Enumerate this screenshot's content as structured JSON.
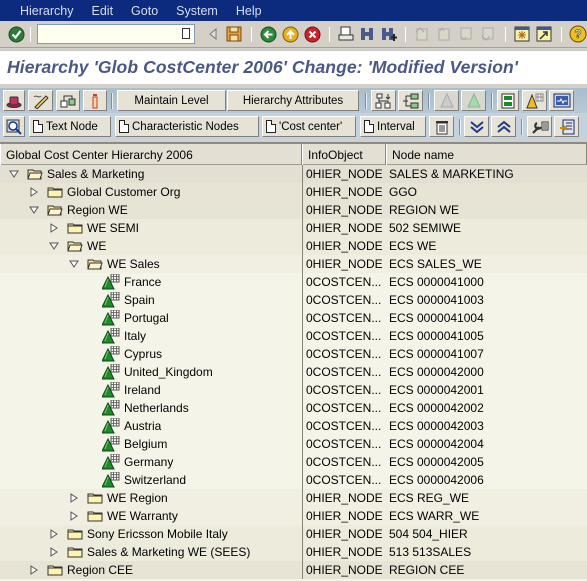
{
  "menubar": {
    "items": [
      {
        "label": "Hierarchy",
        "accel": "i"
      },
      {
        "label": "Edit",
        "accel": "E"
      },
      {
        "label": "Goto",
        "accel": "G"
      },
      {
        "label": "System",
        "accel": "y"
      },
      {
        "label": "Help",
        "accel": "H"
      }
    ]
  },
  "stdbar": {
    "command_field": {
      "value": "",
      "placeholder": ""
    },
    "icons": [
      "enter-icon",
      "history-icon",
      "back-arrow-icon",
      "save-icon",
      "back-icon",
      "exit-icon",
      "cancel-icon",
      "print-icon",
      "find-icon",
      "find-next-icon",
      "first-page-icon",
      "previous-page-icon",
      "next-page-icon",
      "last-page-icon",
      "new-session-icon",
      "shortcut-icon",
      "help-icon"
    ]
  },
  "title": "Hierarchy 'Glob CostCenter 2006' Change: 'Modified Version'",
  "toolbar1": {
    "maintain_level": "Maintain Level",
    "hierarchy_attributes": "Hierarchy Attributes"
  },
  "toolbar2": {
    "text_node": "Text Node",
    "characteristic_nodes": "Characteristic Nodes",
    "cost_center": "'Cost center'",
    "interval": "Interval"
  },
  "tree": {
    "columns": [
      "Global Cost Center Hierarchy 2006",
      "InfoObject",
      "Node name"
    ],
    "rows": [
      {
        "level": 0,
        "type": "folder",
        "state": "expanded",
        "label": "Sales & Marketing",
        "infoobject": "0HIER_NODE",
        "node": "SALES & MARKETING"
      },
      {
        "level": 1,
        "type": "folder",
        "state": "collapsed",
        "label": "Global Customer Org",
        "infoobject": "0HIER_NODE",
        "node": "GGO"
      },
      {
        "level": 1,
        "type": "folder",
        "state": "expanded",
        "label": "Region WE",
        "infoobject": "0HIER_NODE",
        "node": "REGION WE"
      },
      {
        "level": 2,
        "type": "folder",
        "state": "collapsed",
        "label": "WE SEMI",
        "infoobject": "0HIER_NODE",
        "node": "502 SEMIWE"
      },
      {
        "level": 2,
        "type": "folder",
        "state": "expanded",
        "label": "WE",
        "infoobject": "0HIER_NODE",
        "node": "ECS WE"
      },
      {
        "level": 3,
        "type": "folder",
        "state": "expanded",
        "label": "WE Sales",
        "infoobject": "0HIER_NODE",
        "node": "ECS SALES_WE"
      },
      {
        "level": 4,
        "type": "leaf",
        "label": "France",
        "infoobject": "0COSTCEN...",
        "node": "ECS 0000041000"
      },
      {
        "level": 4,
        "type": "leaf",
        "label": "Spain",
        "infoobject": "0COSTCEN...",
        "node": "ECS 0000041003"
      },
      {
        "level": 4,
        "type": "leaf",
        "label": "Portugal",
        "infoobject": "0COSTCEN...",
        "node": "ECS 0000041004"
      },
      {
        "level": 4,
        "type": "leaf",
        "label": "Italy",
        "infoobject": "0COSTCEN...",
        "node": "ECS 0000041005"
      },
      {
        "level": 4,
        "type": "leaf",
        "label": "Cyprus",
        "infoobject": "0COSTCEN...",
        "node": "ECS 0000041007"
      },
      {
        "level": 4,
        "type": "leaf",
        "label": "United_Kingdom",
        "infoobject": "0COSTCEN...",
        "node": "ECS 0000042000"
      },
      {
        "level": 4,
        "type": "leaf",
        "label": "Ireland",
        "infoobject": "0COSTCEN...",
        "node": "ECS 0000042001"
      },
      {
        "level": 4,
        "type": "leaf",
        "label": "Netherlands",
        "infoobject": "0COSTCEN...",
        "node": "ECS 0000042002"
      },
      {
        "level": 4,
        "type": "leaf",
        "label": "Austria",
        "infoobject": "0COSTCEN...",
        "node": "ECS 0000042003"
      },
      {
        "level": 4,
        "type": "leaf",
        "label": "Belgium",
        "infoobject": "0COSTCEN...",
        "node": "ECS 0000042004"
      },
      {
        "level": 4,
        "type": "leaf",
        "label": "Germany",
        "infoobject": "0COSTCEN...",
        "node": "ECS 0000042005"
      },
      {
        "level": 4,
        "type": "leaf",
        "label": "Switzerland",
        "infoobject": "0COSTCEN...",
        "node": "ECS 0000042006"
      },
      {
        "level": 3,
        "type": "folder",
        "state": "collapsed",
        "label": "WE Region",
        "infoobject": "0HIER_NODE",
        "node": "ECS REG_WE"
      },
      {
        "level": 3,
        "type": "folder",
        "state": "collapsed",
        "label": "WE Warranty",
        "infoobject": "0HIER_NODE",
        "node": "ECS WARR_WE"
      },
      {
        "level": 2,
        "type": "folder",
        "state": "collapsed",
        "label": "Sony Ericsson Mobile Italy",
        "infoobject": "0HIER_NODE",
        "node": "504 504_HIER"
      },
      {
        "level": 2,
        "type": "folder",
        "state": "collapsed",
        "label": "Sales & Marketing WE (SEES)",
        "infoobject": "0HIER_NODE",
        "node": "513 513SALES"
      },
      {
        "level": 1,
        "type": "folder",
        "state": "collapsed",
        "label": "Region CEE",
        "infoobject": "0HIER_NODE",
        "node": "REGION CEE"
      }
    ]
  }
}
